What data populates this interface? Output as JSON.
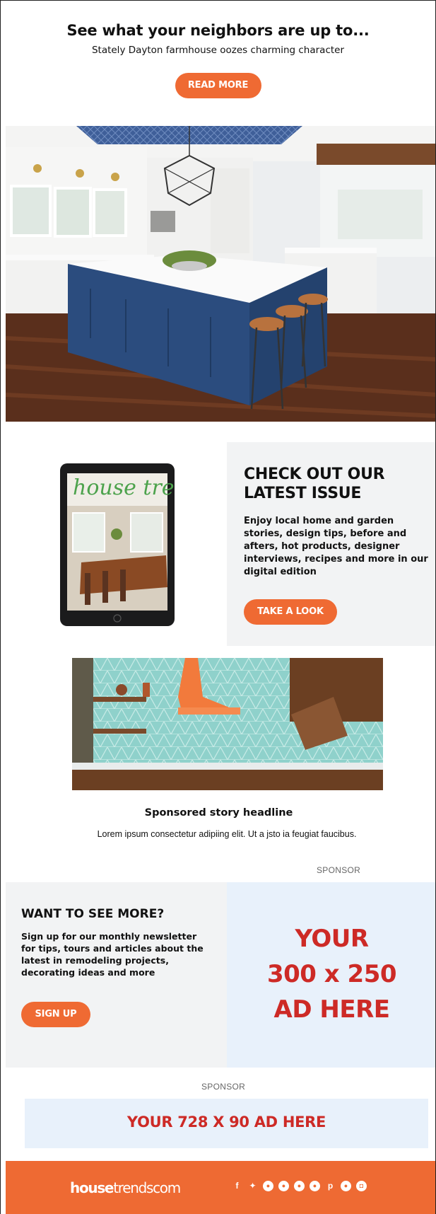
{
  "header": {
    "title": "See what your neighbors are up to...",
    "subtitle": "Stately Dayton farmhouse oozes charming character",
    "button": "READ MORE"
  },
  "issue": {
    "title": "CHECK OUT OUR LATEST ISSUE",
    "body": "Enjoy local home and garden stories, design tips, before and afters, hot products, designer interviews, recipes and more in our digital edition",
    "button": "TAKE A LOOK",
    "magazine_brand": "house trends"
  },
  "story": {
    "headline": "Sponsored story headline",
    "body": "Lorem ipsum consectetur adipiing elit. Ut a jsto ia feugiat faucibus."
  },
  "sponsor_label": "SPONSOR",
  "newsletter": {
    "title": "WANT TO SEE MORE?",
    "body": "Sign up for our monthly newsletter for tips, tours and articles about the latest in remodeling projects, decorating ideas and more",
    "button": "SIGN UP"
  },
  "ad_300": {
    "line1": "YOUR",
    "line2": "300 x 250",
    "line3": "AD HERE"
  },
  "ad_728": {
    "text": "YOUR 728 X 90 AD HERE"
  },
  "footer": {
    "logo_bold": "house",
    "logo_light": "trendscom",
    "social_icons": [
      "facebook-icon",
      "twitter-icon",
      "social-icon-1",
      "social-icon-2",
      "social-icon-3",
      "social-icon-4",
      "pinterest-icon",
      "social-icon-5",
      "instagram-icon"
    ]
  },
  "colors": {
    "accent": "#ef6a33",
    "ad_red": "#cd2a26",
    "panel_grey": "#f2f3f4",
    "ad_blue": "#e8f1fb",
    "island_blue": "#2b4c7e"
  }
}
